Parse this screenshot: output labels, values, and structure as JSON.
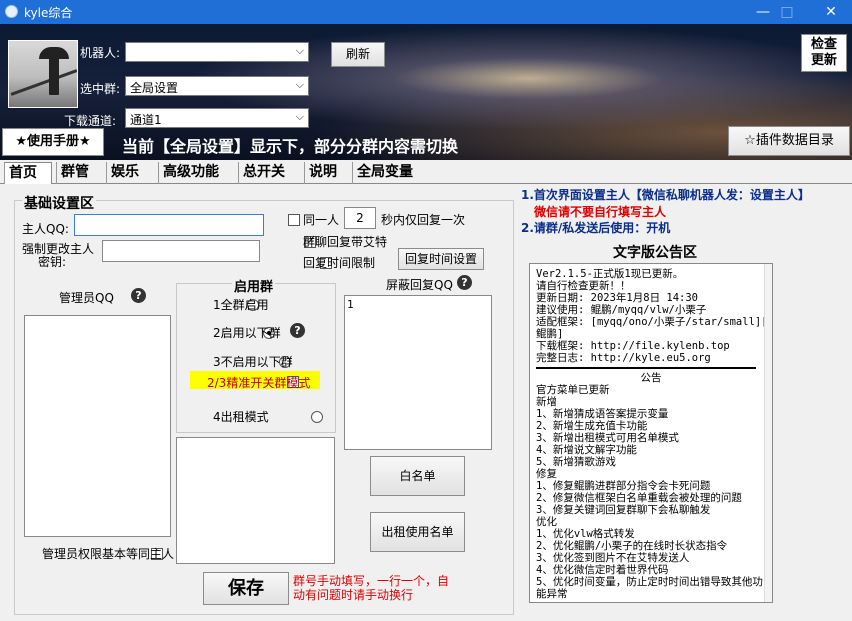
{
  "window": {
    "title": "kyle综合",
    "minimize": "—",
    "maximize": "□",
    "close": "✕"
  },
  "header": {
    "robot_label": "机器人:",
    "robot_value": "",
    "refresh_label": "刷新",
    "group_label": "选中群:",
    "group_value": "全局设置",
    "channel_label": "下载通道:",
    "channel_value": "通道1",
    "check_update_label": "检查\n更新",
    "check_update_line1": "检查",
    "check_update_line2": "更新",
    "manual_label": "★使用手册★",
    "status_message": "当前【全局设置】显示下，部分分群内容需切换",
    "plugin_dir_label": "☆插件数据目录"
  },
  "tabs": [
    "首页",
    "群管",
    "娱乐",
    "高级功能",
    "总开关",
    "说明",
    "全局变量"
  ],
  "basic": {
    "section_title": "基础设置区",
    "owner_qq_label": "主人QQ:",
    "owner_qq_value": "",
    "force_change_label1": "强制更改主人",
    "force_change_label2": "密钥:",
    "force_key_value": "",
    "same_person_label": "同一人",
    "same_person_seconds": "2",
    "same_person_suffix": "秒内仅回复一次",
    "group_reply_label": "群聊回复带艾特",
    "group_reply_checked": true,
    "time_limit_label": "回复时间限制",
    "time_limit_checked": false,
    "time_setting_button": "回复时间设置",
    "admin_qq_label": "管理员QQ",
    "enable_group_title": "启用群",
    "radio1": "1全群启用",
    "radio2": "2启用以下群",
    "radio3": "3不启用以下群",
    "precise_label": "2/3精准开关群模式",
    "radio4": "4出租模式",
    "block_reply_label": "屏蔽回复QQ",
    "block_reply_value": "1",
    "whitelist_button": "白名单",
    "rent_list_button": "出租使用名单",
    "admin_same_label": "管理员权限基本等同主人",
    "save_button": "保存",
    "hint_text": "群号手动填写，一行一个，自动有问题时请手动换行"
  },
  "right": {
    "note1": "1.首次界面设置主人【微信私聊机器人发：设置主人】",
    "note2": "微信请不要自行填写主人",
    "note3": "2.请群/私发送后使用：开机",
    "notice_title": "文字版公告区",
    "notice_lines": [
      "Ver2.1.5-正式版1现已更新。",
      "请自行检查更新！！",
      "更新日期: 2023年1月8日 14:30",
      "建议使用: 鲲鹏/myqq/vlw/小栗子",
      "适配框架: [myqq/ono/小栗子/star/small][vlw/",
      "鲲鹏]",
      "下载框架: http://file.kylenb.top",
      "完整日志: http://kyle.eu5.org",
      "",
      "公告",
      "官方菜单已更新",
      "新增",
      "1、新增猜成语答案提示变量",
      "2、新增生成充值卡功能",
      "3、新增出租模式可用名单模式",
      "4、新增说文解字功能",
      "5、新增猜歌游戏",
      "修复",
      "1、修复鲲鹏进群部分指令会卡死问题",
      "2、修复微信框架白名单重载会被处理的问题",
      "3、修复关键词回复群聊下会私聊触发",
      "优化",
      "1、优化vlw格式转发",
      "2、优化鲲鹏/小栗子的在线时长状态指令",
      "3、优化签到图片不在艾特发送人",
      "4、优化微信定时着世界代码",
      "5、优化时间变量，防止定时时间出错导致其他功",
      "能异常"
    ]
  }
}
